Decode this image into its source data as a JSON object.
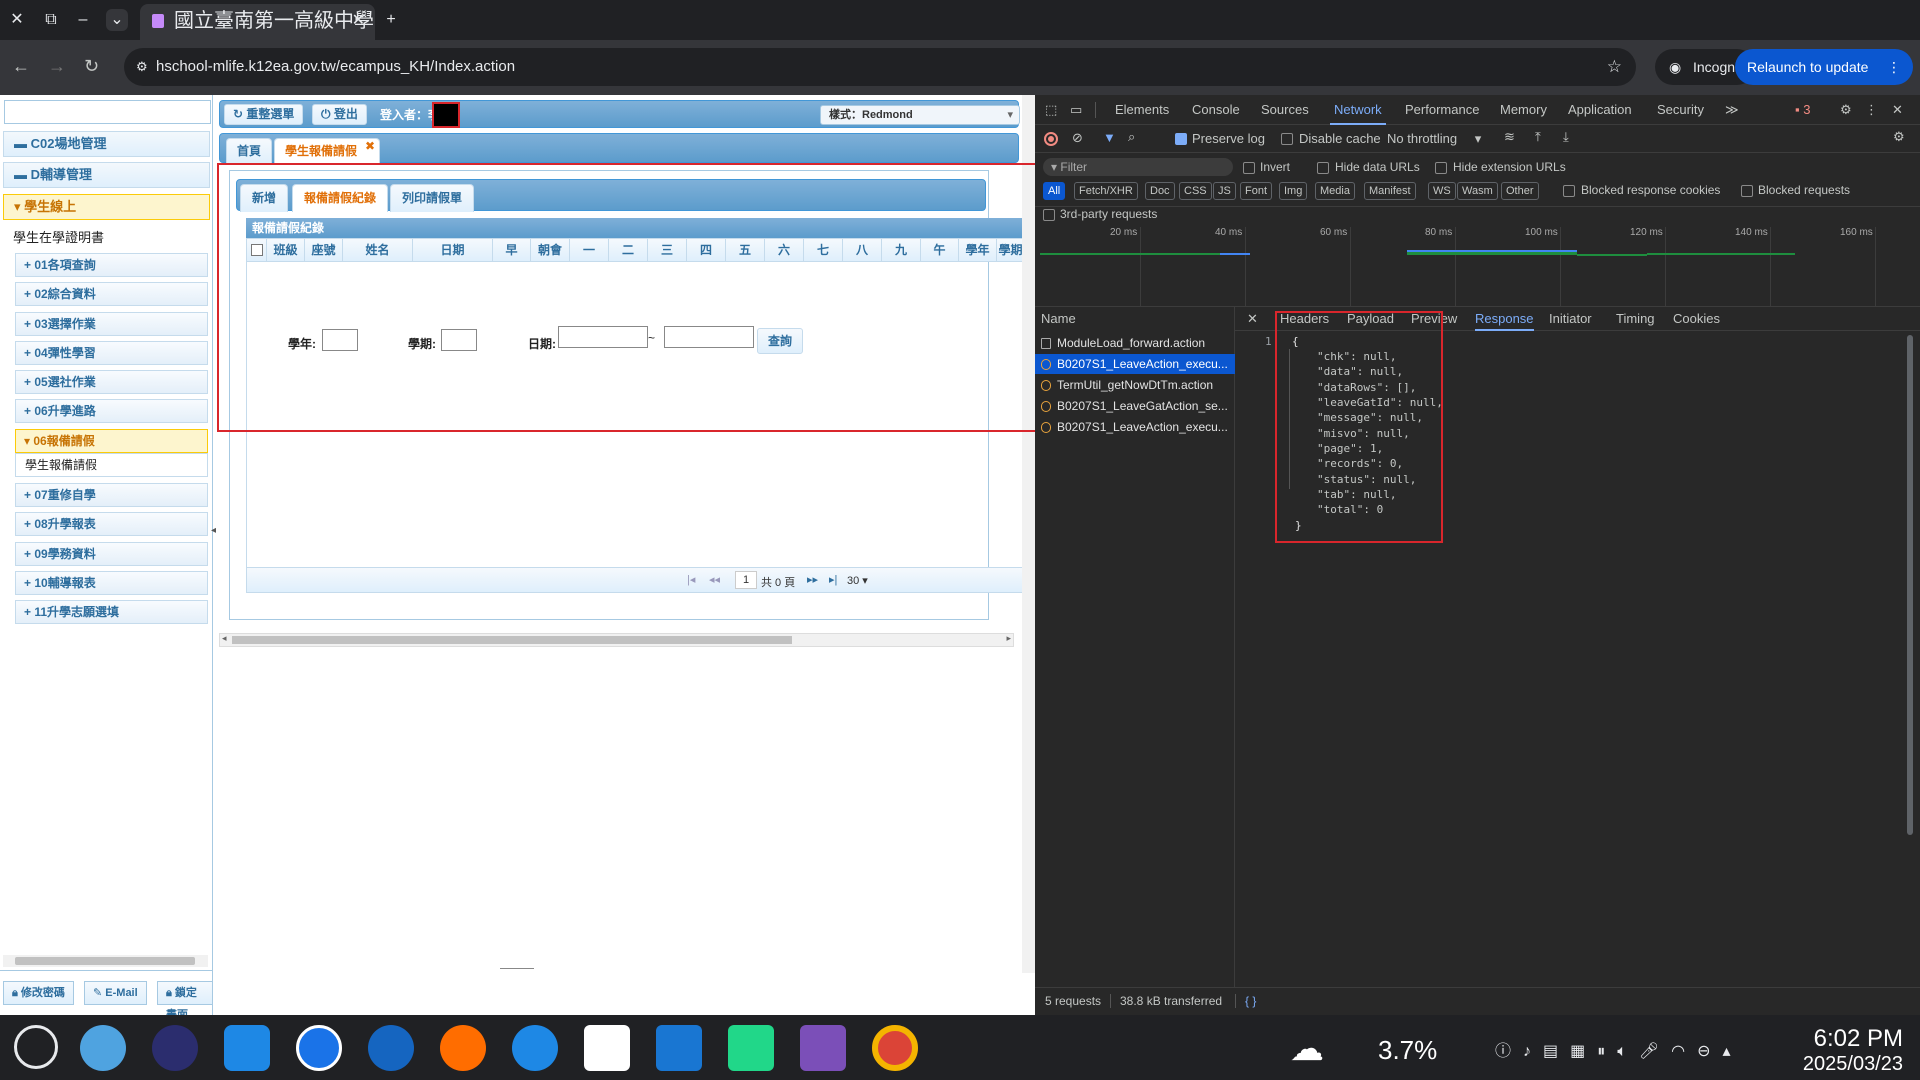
{
  "browser": {
    "tab_title": "國立臺南第一高級中學",
    "url": "hschool-mlife.k12ea.gov.tw/ecampus_KH/Index.action",
    "incognito_label": "Incognito",
    "relaunch_label": "Relaunch to update"
  },
  "sidebar": {
    "cat_c02": "C02場地管理",
    "cat_d": "D輔導管理",
    "cat_student": "學生線上",
    "student_cert": "學生在學證明書",
    "subs": [
      "01各項查詢",
      "02綜合資料",
      "03選擇作業",
      "04彈性學習",
      "05選社作業",
      "06升學進路"
    ],
    "sub_leave": "06報備請假",
    "leave_item": "學生報備請假",
    "subs2": [
      "07重修自學",
      "08升學報表",
      "09學務資料",
      "10輔導報表",
      "11升學志願選填"
    ],
    "btn_pw": "修改密碼",
    "btn_email": "E-Mail",
    "btn_lock": "鎖定畫面"
  },
  "toolbar": {
    "reset_menu": "重整選單",
    "logout": "登出",
    "login_user_label": "登入者：李",
    "style_label": "樣式：Redmond"
  },
  "page_tabs": {
    "home": "首頁",
    "leave": "學生報備請假"
  },
  "inner_tabs": {
    "add": "新增",
    "record": "報備請假紀錄",
    "print": "列印請假單"
  },
  "form": {
    "year": "學年:",
    "term": "學期:",
    "date": "日期:",
    "tilde": "~",
    "query": "查詢"
  },
  "grid": {
    "title": "報備請假紀錄",
    "columns": [
      "班級",
      "座號",
      "姓名",
      "日期",
      "早",
      "朝會",
      "一",
      "二",
      "三",
      "四",
      "五",
      "六",
      "七",
      "八",
      "九",
      "午",
      "學年",
      "學期"
    ],
    "pager_page": "1",
    "pager_total": "共 0 頁",
    "pager_size": "30"
  },
  "devtools": {
    "tabs": [
      "Elements",
      "Console",
      "Sources",
      "Network",
      "Performance",
      "Memory",
      "Application",
      "Security"
    ],
    "error_count": "3",
    "preserve_log": "Preserve log",
    "disable_cache": "Disable cache",
    "throttling": "No throttling",
    "filter_placeholder": "Filter",
    "invert": "Invert",
    "hide_data_urls": "Hide data URLs",
    "hide_ext_urls": "Hide extension URLs",
    "chips": [
      "All",
      "Fetch/XHR",
      "Doc",
      "CSS",
      "JS",
      "Font",
      "Img",
      "Media",
      "Manifest",
      "WS",
      "Wasm",
      "Other"
    ],
    "blocked_cookies": "Blocked response cookies",
    "blocked_requests": "Blocked requests",
    "third_party": "3rd-party requests",
    "ticks": [
      "20 ms",
      "40 ms",
      "60 ms",
      "80 ms",
      "100 ms",
      "120 ms",
      "140 ms",
      "160 ms"
    ],
    "name_header": "Name",
    "requests": [
      "ModuleLoad_forward.action",
      "B0207S1_LeaveAction_execu...",
      "TermUtil_getNowDtTm.action",
      "B0207S1_LeaveGatAction_se...",
      "B0207S1_LeaveAction_execu..."
    ],
    "detail_tabs": [
      "Headers",
      "Payload",
      "Preview",
      "Response",
      "Initiator",
      "Timing",
      "Cookies"
    ],
    "json_lines": [
      "{",
      "\"chk\": null,",
      "\"data\": null,",
      "\"dataRows\": [],",
      "\"leaveGatId\": null,",
      "\"message\": null,",
      "\"misvo\": null,",
      "\"page\": 1,",
      "\"records\": 0,",
      "\"status\": null,",
      "\"tab\": null,",
      "\"total\": 0",
      "}"
    ],
    "line_number": "1",
    "status_requests": "5 requests",
    "status_transferred": "38.8 kB transferred"
  },
  "taskbar": {
    "weather_value": "3.7%",
    "time": "6:02 PM",
    "date": "2025/03/23"
  }
}
